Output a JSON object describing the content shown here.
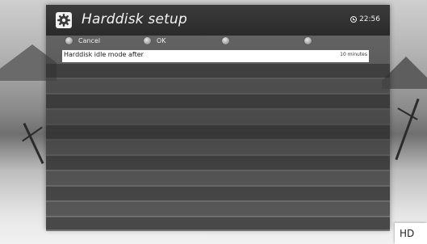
{
  "header": {
    "title": "Harddisk setup",
    "time": "22:56"
  },
  "softkeys": [
    {
      "label": "Cancel"
    },
    {
      "label": "OK"
    },
    {
      "label": ""
    },
    {
      "label": ""
    }
  ],
  "settings": [
    {
      "label": "Harddisk idle mode after",
      "value": "10 minutes"
    }
  ],
  "badge": "HD",
  "colors": {
    "panel": "#3c3c3c",
    "selected_row": "#ffffff",
    "text_light": "#f4f4f4"
  },
  "icons": {
    "header": "gear-icon",
    "clock": "clock-icon",
    "softkey": "key-dot-icon"
  }
}
